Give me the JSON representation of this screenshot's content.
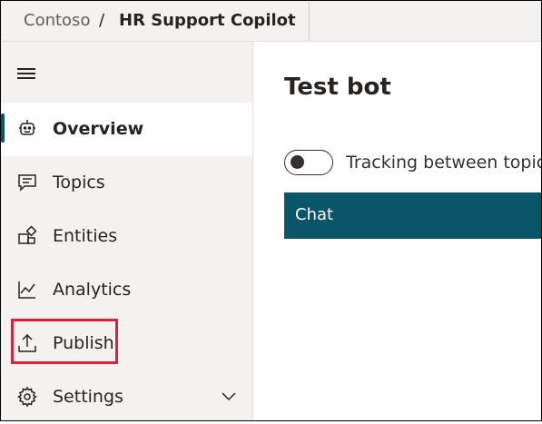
{
  "header": {
    "org": "Contoso",
    "separator": "/",
    "app_name": "HR Support Copilot"
  },
  "sidebar": {
    "menu_icon": "hamburger-icon",
    "items": [
      {
        "label": "Overview",
        "icon": "bot-icon",
        "active": true
      },
      {
        "label": "Topics",
        "icon": "chat-bubble-icon",
        "active": false
      },
      {
        "label": "Entities",
        "icon": "entities-icon",
        "active": false
      },
      {
        "label": "Analytics",
        "icon": "chart-line-icon",
        "active": false
      },
      {
        "label": "Publish",
        "icon": "upload-icon",
        "active": false,
        "highlighted": true
      },
      {
        "label": "Settings",
        "icon": "gear-icon",
        "active": false,
        "expandable": true
      }
    ]
  },
  "main": {
    "title": "Test bot",
    "tracking_toggle": {
      "label": "Tracking between topics",
      "on": false
    },
    "chat": {
      "title": "Chat"
    }
  },
  "colors": {
    "accent": "#0b556a",
    "sidebar_bg": "#f3f2f1",
    "highlight": "#e0203a"
  }
}
